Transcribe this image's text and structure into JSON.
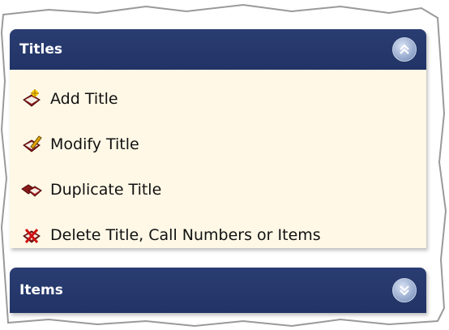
{
  "sections": {
    "titles": {
      "header": "Titles",
      "items": [
        {
          "label": "Add Title",
          "icon": "book-add-icon"
        },
        {
          "label": "Modify Title",
          "icon": "book-edit-icon"
        },
        {
          "label": "Duplicate Title",
          "icon": "book-duplicate-icon"
        },
        {
          "label": "Delete Title, Call Numbers or Items",
          "icon": "book-delete-icon"
        }
      ]
    },
    "items": {
      "header": "Items"
    }
  },
  "colors": {
    "header_bg": "#223466",
    "panel_bg": "#fff8e6",
    "header_text": "#ffffff"
  }
}
